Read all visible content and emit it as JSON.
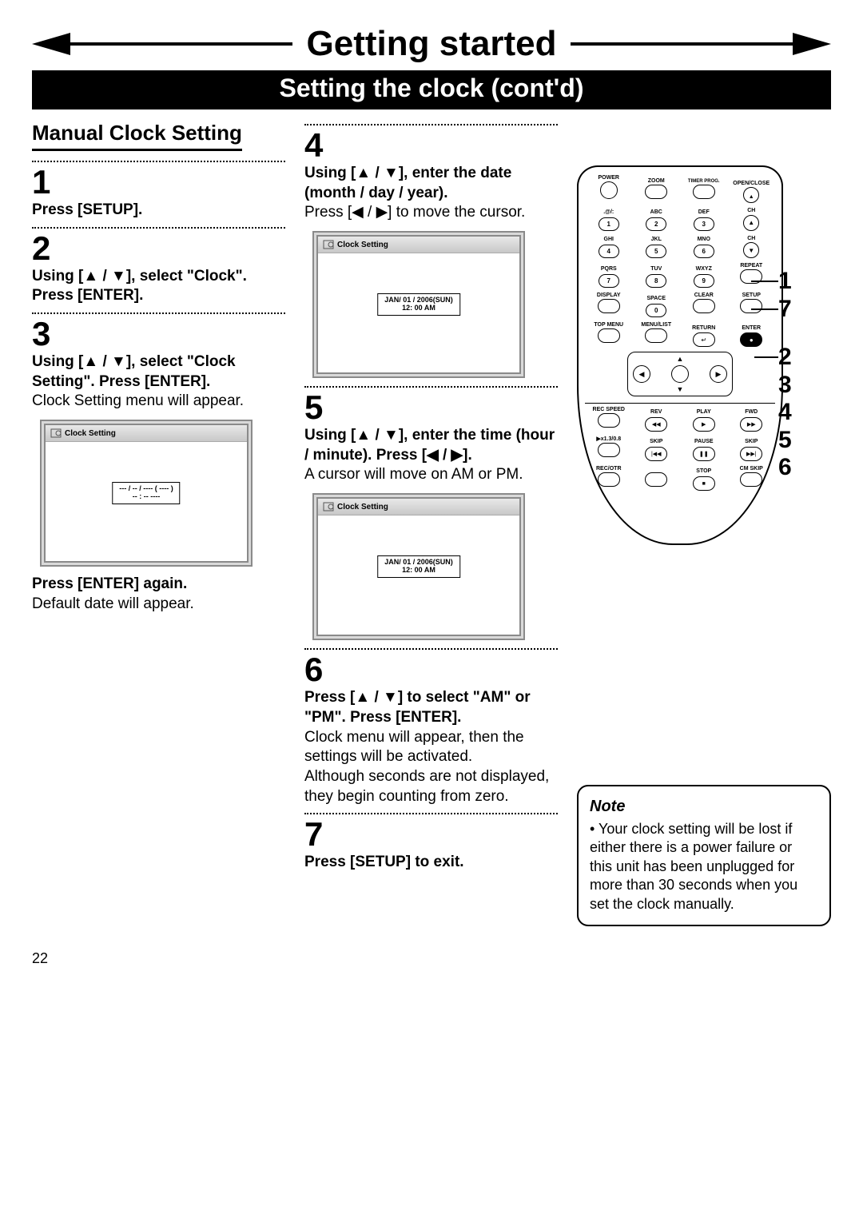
{
  "header": {
    "title": "Getting started",
    "subtitle": "Setting the clock (cont'd)"
  },
  "section_title": "Manual Clock Setting",
  "steps": {
    "s1": {
      "num": "1",
      "bold": "Press [SETUP]."
    },
    "s2": {
      "num": "2",
      "bold": "Using [▲ / ▼], select \"Clock\". Press [ENTER]."
    },
    "s3": {
      "num": "3",
      "bold": "Using [▲ / ▼], select \"Clock Setting\". Press [ENTER].",
      "plain": "Clock Setting menu will appear.",
      "after_bold": "Press [ENTER] again.",
      "after_plain": "Default date will appear."
    },
    "s4": {
      "num": "4",
      "bold": "Using [▲ / ▼], enter the date (month / day / year).",
      "plain": "Press [◀ / ▶] to move the cursor."
    },
    "s5": {
      "num": "5",
      "bold": "Using [▲ / ▼], enter the time (hour / minute). Press [◀ / ▶].",
      "plain": "A cursor will move on AM or PM."
    },
    "s6": {
      "num": "6",
      "bold": "Press [▲ / ▼] to select \"AM\" or \"PM\". Press [ENTER].",
      "plain": "Clock menu will appear, then the settings will be activated.\nAlthough seconds are not displayed, they begin counting from zero."
    },
    "s7": {
      "num": "7",
      "bold": "Press [SETUP] to exit."
    }
  },
  "screens": {
    "title": "Clock Setting",
    "blank": {
      "l1": "--- / -- / ---- ( ---- )",
      "l2": "-- : --  ----"
    },
    "dated": {
      "l1": "JAN/ 01 / 2006(SUN)",
      "l2": "12: 00   AM"
    }
  },
  "note": {
    "heading": "Note",
    "body": "• Your clock setting will be lost if either there is a power failure or this unit has been unplugged for more than 30 seconds when you set the clock manually."
  },
  "remote": {
    "row_top": [
      "POWER",
      "",
      "TIMER PROG.",
      "OPEN/CLOSE"
    ],
    "row_top2": [
      "",
      "ZOOM",
      "",
      ""
    ],
    "numrows": [
      {
        "labels": [
          ".@/:",
          "ABC",
          "DEF",
          "CH"
        ],
        "nums": [
          "1",
          "2",
          "3",
          "▲"
        ]
      },
      {
        "labels": [
          "GHI",
          "JKL",
          "MNO",
          "CH"
        ],
        "nums": [
          "4",
          "5",
          "6",
          "▼"
        ]
      },
      {
        "labels": [
          "PQRS",
          "TUV",
          "WXYZ",
          "REPEAT"
        ],
        "nums": [
          "7",
          "8",
          "9",
          ""
        ]
      },
      {
        "labels": [
          "DISPLAY",
          "SPACE",
          "CLEAR",
          "SETUP"
        ],
        "nums": [
          "",
          "0",
          "",
          ""
        ]
      }
    ],
    "row_menu": [
      "TOP MENU",
      "MENU/LIST",
      "RETURN",
      "ENTER"
    ],
    "row_trans1": {
      "labels": [
        "REC SPEED",
        "REV",
        "PLAY",
        "FWD"
      ],
      "glyphs": [
        "",
        "◀◀",
        "▶",
        "▶▶"
      ]
    },
    "row_trans2": {
      "labels": [
        "▶x1.3/0.8",
        "SKIP",
        "PAUSE",
        "SKIP"
      ],
      "glyphs": [
        "",
        "|◀◀",
        "❚❚",
        "▶▶|"
      ]
    },
    "row_trans3": {
      "labels": [
        "REC/OTR",
        "",
        "STOP",
        "CM SKIP"
      ],
      "glyphs": [
        "",
        "",
        "■",
        ""
      ]
    }
  },
  "callouts": {
    "right_top": [
      "1",
      "7"
    ],
    "right_mid": [
      "2",
      "3",
      "4",
      "5",
      "6"
    ]
  },
  "page_number": "22"
}
